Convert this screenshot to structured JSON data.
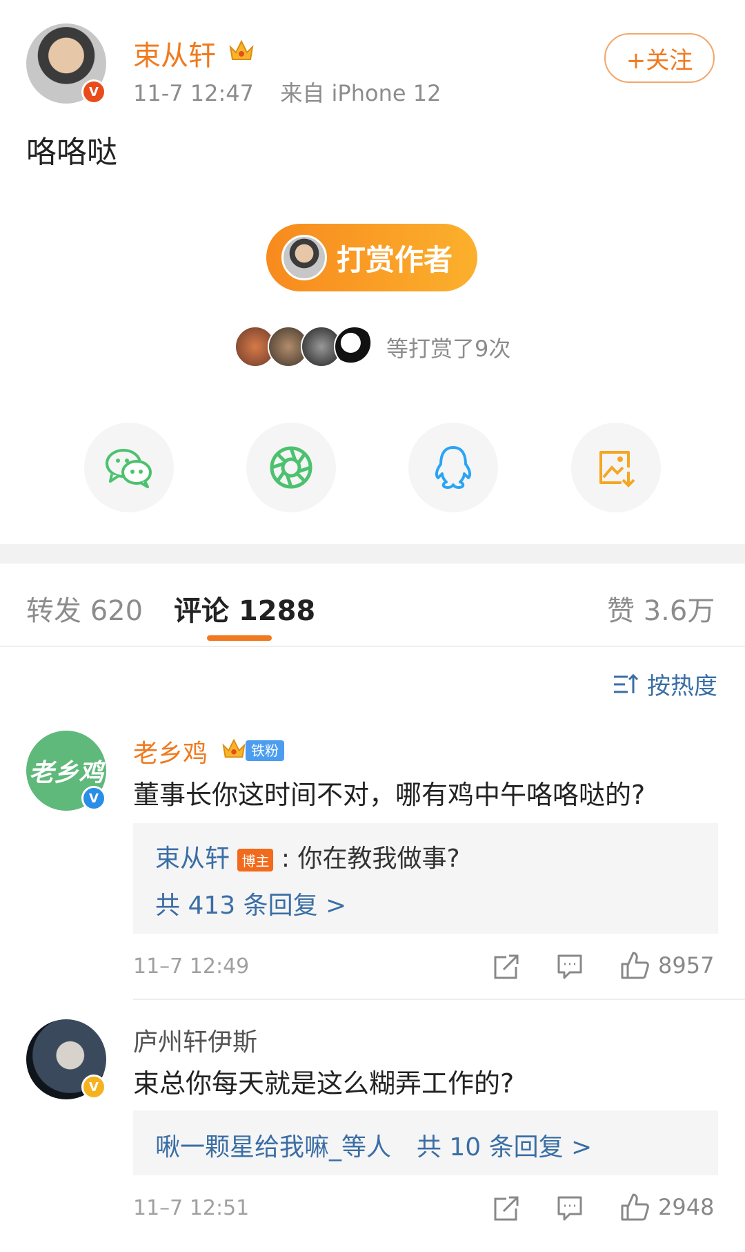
{
  "post": {
    "author_name": "束从轩",
    "timestamp": "11-7 12:47",
    "source": "来自 iPhone 12",
    "follow_label": "+关注",
    "content": "咯咯哒",
    "verified_mark": "V"
  },
  "reward": {
    "button_label": "打赏作者",
    "summary": "等打赏了9次"
  },
  "share": {
    "items": [
      "wechat-icon",
      "moments-icon",
      "qq-icon",
      "save-image-icon"
    ]
  },
  "tabs": {
    "repost_label": "转发",
    "repost_count": "620",
    "comment_label": "评论",
    "comment_count": "1288",
    "like_label": "赞",
    "like_count": "3.6万"
  },
  "sort": {
    "label": "按热度"
  },
  "comments": [
    {
      "author": "老乡鸡",
      "avatar_text": "老乡鸡",
      "badge_label": "铁粉",
      "text": "董事长你这时间不对，哪有鸡中午咯咯哒的?",
      "reply_author": "束从轩",
      "reply_tag": "博主",
      "reply_text": ": 你在教我做事?",
      "reply_total": "共 413 条回复 >",
      "time": "11–7 12:49",
      "likes": "8957"
    },
    {
      "author": "庐州轩伊斯",
      "text": "束总你每天就是这么糊弄工作的?",
      "reply_author": "啾一颗星给我嘛_等人",
      "reply_total": "共 10 条回复 >",
      "time": "11–7 12:51",
      "likes": "2948"
    }
  ],
  "colors": {
    "accent": "#f07a1f",
    "link": "#3a6ea5",
    "wechat": "#4cc16f",
    "qq": "#2aa4f4",
    "save": "#f5a623"
  }
}
